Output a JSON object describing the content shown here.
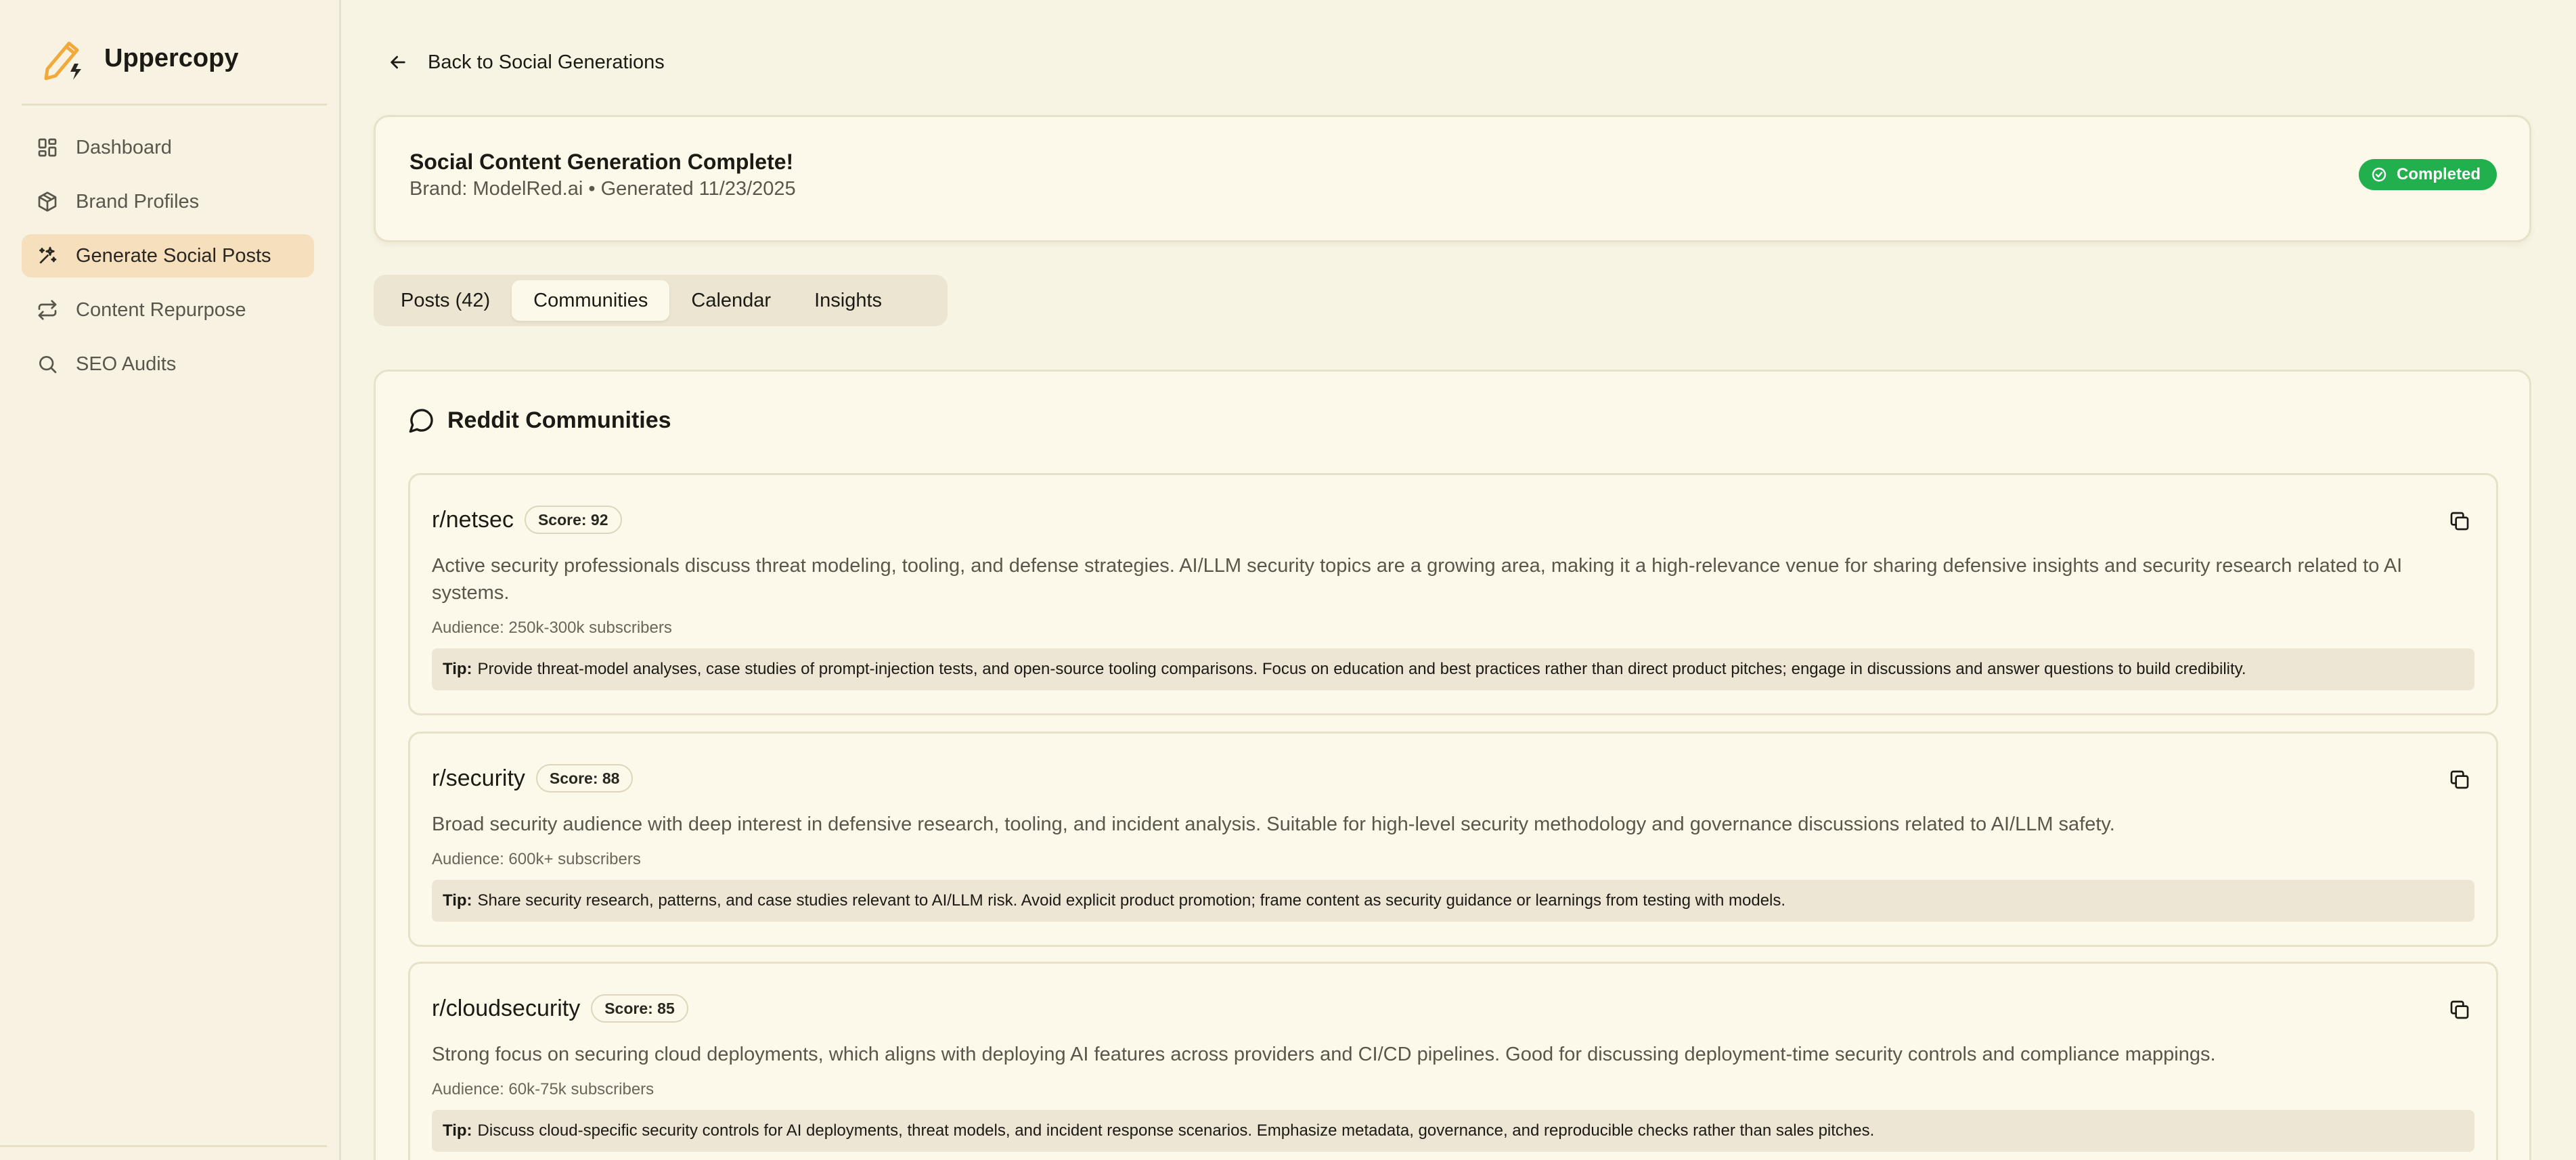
{
  "app": {
    "name": "Uppercopy"
  },
  "sidebar": {
    "items": [
      {
        "label": "Dashboard",
        "icon": "dashboard-icon"
      },
      {
        "label": "Brand Profiles",
        "icon": "box-icon"
      },
      {
        "label": "Generate Social Posts",
        "icon": "sparkles-icon",
        "active": true
      },
      {
        "label": "Content Repurpose",
        "icon": "repeat-icon"
      },
      {
        "label": "SEO Audits",
        "icon": "search-icon"
      }
    ]
  },
  "header": {
    "back_label": "Back to Social Generations"
  },
  "summary": {
    "title": "Social Content Generation Complete!",
    "subtitle": "Brand: ModelRed.ai • Generated 11/23/2025",
    "status": "Completed",
    "status_color": "#22b04e"
  },
  "tabs": [
    {
      "label": "Posts (42)"
    },
    {
      "label": "Communities",
      "active": true
    },
    {
      "label": "Calendar"
    },
    {
      "label": "Insights"
    }
  ],
  "communities": {
    "heading": "Reddit Communities",
    "tip_label": "Tip:",
    "items": [
      {
        "name": "r/netsec",
        "score": "Score: 92",
        "description": "Active security professionals discuss threat modeling, tooling, and defense strategies. AI/LLM security topics are a growing area, making it a high-relevance venue for sharing defensive insights and security research related to AI systems.",
        "audience": "Audience: 250k-300k subscribers",
        "tip": "Provide threat-model analyses, case studies of prompt-injection tests, and open-source tooling comparisons. Focus on education and best practices rather than direct product pitches; engage in discussions and answer questions to build credibility."
      },
      {
        "name": "r/security",
        "score": "Score: 88",
        "description": "Broad security audience with deep interest in defensive research, tooling, and incident analysis. Suitable for high-level security methodology and governance discussions related to AI/LLM safety.",
        "audience": "Audience: 600k+ subscribers",
        "tip": "Share security research, patterns, and case studies relevant to AI/LLM risk. Avoid explicit product promotion; frame content as security guidance or learnings from testing with models."
      },
      {
        "name": "r/cloudsecurity",
        "score": "Score: 85",
        "description": "Strong focus on securing cloud deployments, which aligns with deploying AI features across providers and CI/CD pipelines. Good for discussing deployment-time security controls and compliance mappings.",
        "audience": "Audience: 60k-75k subscribers",
        "tip": "Discuss cloud-specific security controls for AI deployments, threat models, and incident response scenarios. Emphasize metadata, governance, and reproducible checks rather than sales pitches."
      }
    ]
  }
}
